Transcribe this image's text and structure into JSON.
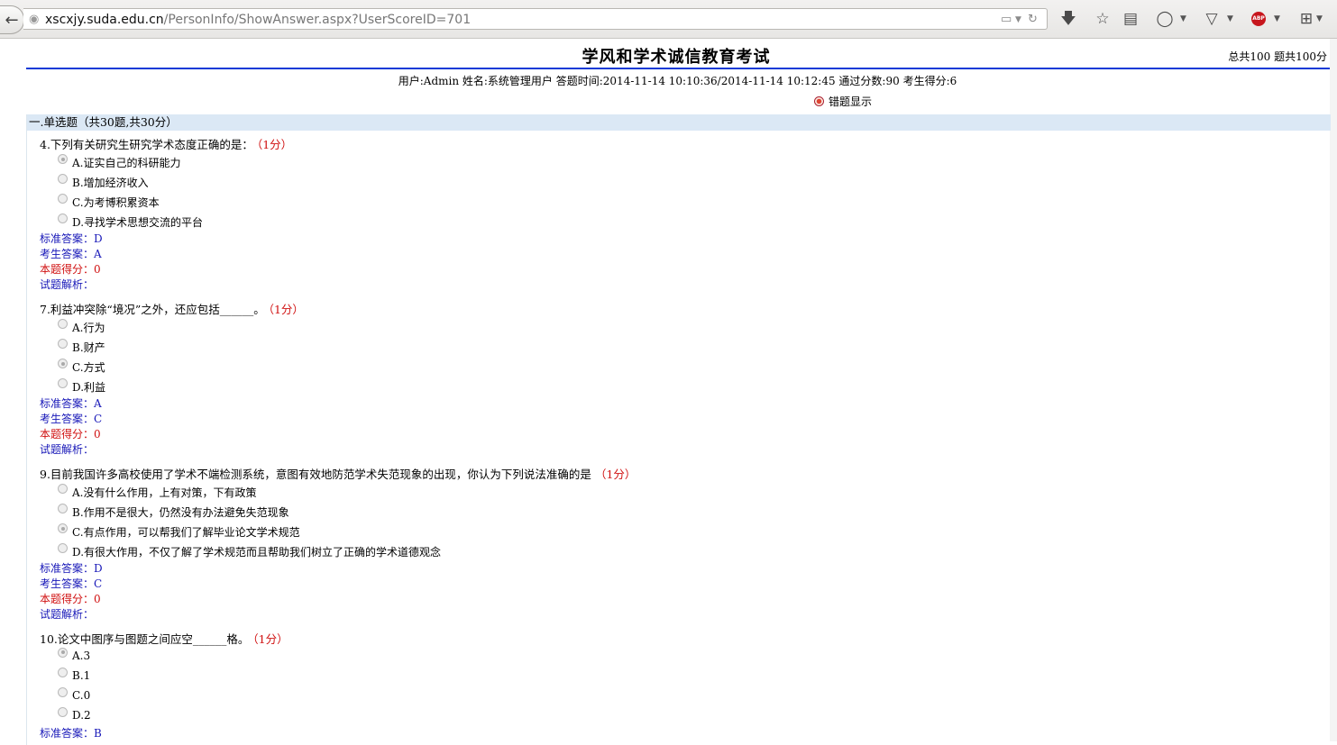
{
  "browser": {
    "back_icon": "arrow-left",
    "url_host": "xscxjy.suda.edu.cn",
    "url_path": "/PersonInfo/ShowAnswer.aspx?UserScoreID=701",
    "abp_label": "ABP"
  },
  "header": {
    "title": "学风和学术诚信教育考试",
    "total_info": "总共100 题共100分",
    "user_info": "用户:Admin  姓名:系统管理用户  答题时间:2014-11-14 10:10:36/2014-11-14 10:12:45  通过分数:90  考生得分:6",
    "wrong_toggle_label": "错题显示"
  },
  "section": {
    "heading": "一.单选题（共30题,共30分）"
  },
  "labels": {
    "standard": "标准答案：",
    "student": "考生答案：",
    "score": "本题得分：",
    "analysis": "试题解析："
  },
  "questions": [
    {
      "title": "4.下列有关研究生研究学术态度正确的是：",
      "points": "（1分）",
      "options": [
        "A.证实自己的科研能力",
        "B.增加经济收入",
        "C.为考博积累资本",
        "D.寻找学术思想交流的平台"
      ],
      "selected": 0,
      "standard": "D",
      "student": "A",
      "score": "0"
    },
    {
      "title": "7.利益冲突除“境况”之外，还应包括______。",
      "points": "（1分）",
      "options": [
        "A.行为",
        "B.财产",
        "C.方式",
        "D.利益"
      ],
      "selected": 2,
      "standard": "A",
      "student": "C",
      "score": "0"
    },
    {
      "title": "9.目前我国许多高校使用了学术不端检测系统，意图有效地防范学术失范现象的出现，你认为下列说法准确的是",
      "points": "（1分）",
      "options": [
        "A.没有什么作用，上有对策，下有政策",
        "B.作用不是很大，仍然没有办法避免失范现象",
        "C.有点作用，可以帮我们了解毕业论文学术规范",
        "D.有很大作用，不仅了解了学术规范而且帮助我们树立了正确的学术道德观念"
      ],
      "selected": 2,
      "standard": "D",
      "student": "C",
      "score": "0"
    },
    {
      "title": "10.论文中图序与图题之间应空______格。",
      "points": "（1分）",
      "options": [
        "A.3",
        "B.1",
        "C.0",
        "D.2"
      ],
      "selected": 0,
      "standard": "B"
    }
  ]
}
